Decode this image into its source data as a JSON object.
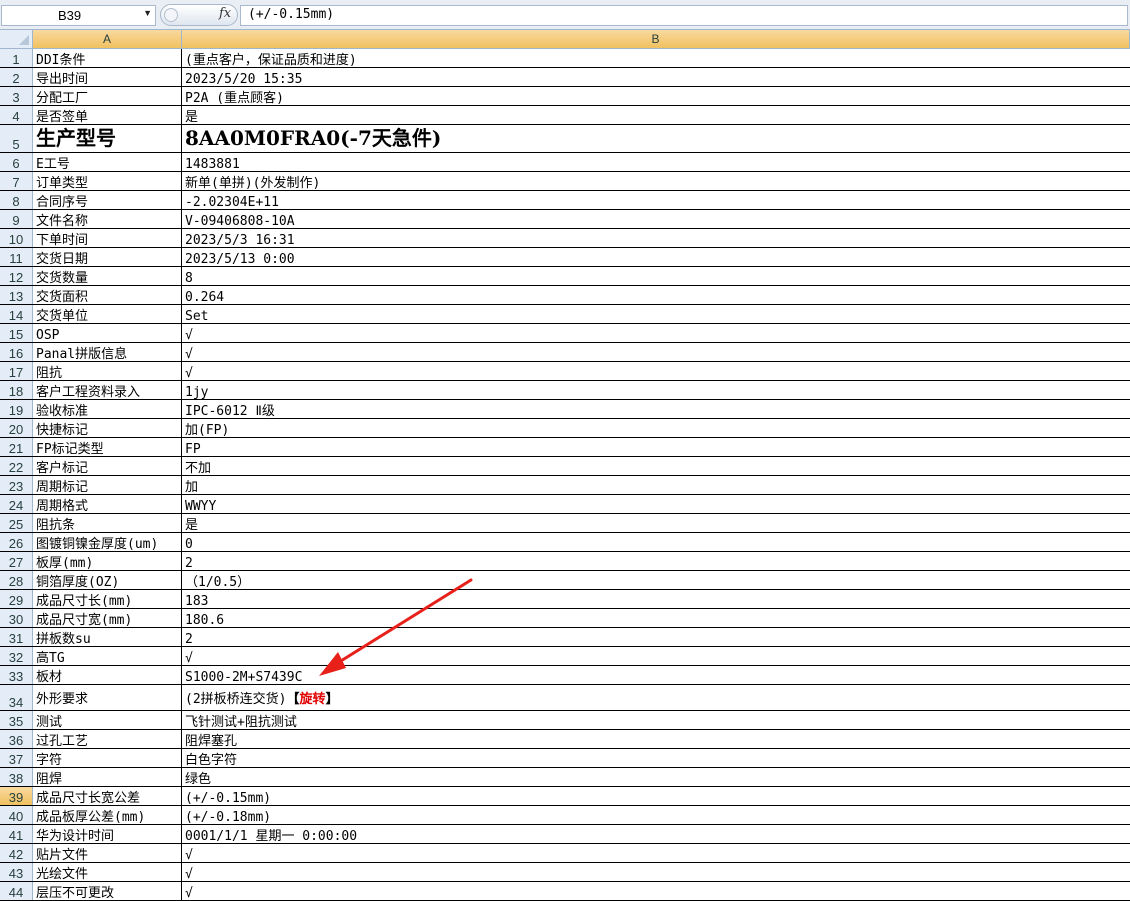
{
  "formula_bar": {
    "name_box": "B39",
    "fx_label": "fx",
    "formula": "(+/-0.15mm)"
  },
  "columns": [
    "A",
    "B"
  ],
  "selected_row": "39",
  "rows": [
    {
      "n": "1",
      "a": "DDI条件",
      "b": "(重点客户，保证品质和进度)"
    },
    {
      "n": "2",
      "a": "导出时间",
      "b": "2023/5/20 15:35"
    },
    {
      "n": "3",
      "a": "分配工厂",
      "b": "P2A (重点顾客)"
    },
    {
      "n": "4",
      "a": "是否签单",
      "b": "是"
    },
    {
      "n": "5",
      "a": "生产型号",
      "b": "8AA0M0FRA0(-7天急件)"
    },
    {
      "n": "6",
      "a": "E工号",
      "b": "1483881"
    },
    {
      "n": "7",
      "a": "订单类型",
      "b": "新单(单拼)(外发制作)"
    },
    {
      "n": "8",
      "a": "合同序号",
      "b": "-2.02304E+11"
    },
    {
      "n": "9",
      "a": "文件名称",
      "b": "V-09406808-10A"
    },
    {
      "n": "10",
      "a": "下单时间",
      "b": "2023/5/3 16:31"
    },
    {
      "n": "11",
      "a": "交货日期",
      "b": "2023/5/13 0:00"
    },
    {
      "n": "12",
      "a": "交货数量",
      "b": "8"
    },
    {
      "n": "13",
      "a": "交货面积",
      "b": "0.264"
    },
    {
      "n": "14",
      "a": "交货单位",
      "b": "Set"
    },
    {
      "n": "15",
      "a": "OSP",
      "b": "√"
    },
    {
      "n": "16",
      "a": "Panal拼版信息",
      "b": "√"
    },
    {
      "n": "17",
      "a": "阻抗",
      "b": "√"
    },
    {
      "n": "18",
      "a": "客户工程资料录入",
      "b": "1jy"
    },
    {
      "n": "19",
      "a": "验收标准",
      "b": "IPC-6012 Ⅱ级"
    },
    {
      "n": "20",
      "a": "快捷标记",
      "b": "加(FP)"
    },
    {
      "n": "21",
      "a": "FP标记类型",
      "b": "FP"
    },
    {
      "n": "22",
      "a": "客户标记",
      "b": "不加"
    },
    {
      "n": "23",
      "a": "周期标记",
      "b": "加"
    },
    {
      "n": "24",
      "a": "周期格式",
      "b": "WWYY"
    },
    {
      "n": "25",
      "a": "阻抗条",
      "b": "是"
    },
    {
      "n": "26",
      "a": "图镀铜镍金厚度(um)",
      "b": "0"
    },
    {
      "n": "27",
      "a": "板厚(mm)",
      "b": "2"
    },
    {
      "n": "28",
      "a": "铜箔厚度(OZ)",
      "b": "（1/0.5）"
    },
    {
      "n": "29",
      "a": "成品尺寸长(mm)",
      "b": "183"
    },
    {
      "n": "30",
      "a": "成品尺寸宽(mm)",
      "b": "180.6"
    },
    {
      "n": "31",
      "a": "拼板数su",
      "b": "2"
    },
    {
      "n": "32",
      "a": "高TG",
      "b": "√"
    },
    {
      "n": "33",
      "a": "板材",
      "b": "S1000-2M+S7439C"
    },
    {
      "n": "34",
      "a": "外形要求",
      "b": "(2拼板桥连交货)",
      "b_open": "【",
      "b_red": "旋转",
      "b_close": "】"
    },
    {
      "n": "35",
      "a": "测试",
      "b": "飞针测试+阻抗测试"
    },
    {
      "n": "36",
      "a": "过孔工艺",
      "b": "阻焊塞孔"
    },
    {
      "n": "37",
      "a": "字符",
      "b": "白色字符"
    },
    {
      "n": "38",
      "a": "阻焊",
      "b": "绿色"
    },
    {
      "n": "39",
      "a": "成品尺寸长宽公差",
      "b": "(+/-0.15mm)"
    },
    {
      "n": "40",
      "a": "成品板厚公差(mm)",
      "b": "(+/-0.18mm)"
    },
    {
      "n": "41",
      "a": "华为设计时间",
      "b": "0001/1/1 星期一 0:00:00"
    },
    {
      "n": "42",
      "a": "贴片文件",
      "b": "√"
    },
    {
      "n": "43",
      "a": "光绘文件",
      "b": "√"
    },
    {
      "n": "44",
      "a": "层压不可更改",
      "b": "√"
    }
  ],
  "annotation": {
    "arrow_color": "#e8201a"
  }
}
